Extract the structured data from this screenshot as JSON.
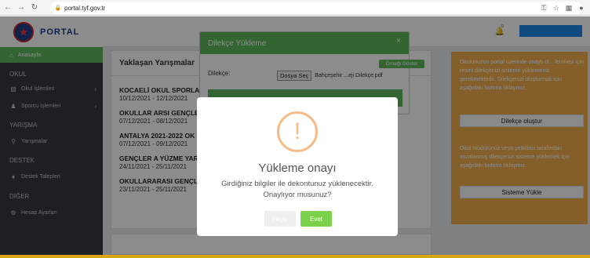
{
  "browser": {
    "url": "portal.tyf.gov.tr"
  },
  "logo": {
    "name": "PORTAL"
  },
  "sidebar": {
    "active": "Anasayfa",
    "sections": {
      "okul": "OKUL",
      "yarisma": "YARIŞMA",
      "destek": "DESTEK",
      "diger": "DİĞER"
    },
    "items": {
      "okul_islemleri": "Okul İşlemleri",
      "sporcu_islemleri": "Sporcu İşlemleri",
      "yarismalar": "Yarışmalar",
      "destek_talepleri": "Destek Talepleri",
      "hesap_ayarlari": "Hesap Ayarları"
    }
  },
  "topbar": {
    "notification_count": "0"
  },
  "card": {
    "title": "Yaklaşan Yarışmalar",
    "competitions": [
      {
        "title": "KOCAELİ OKUL SPORLARI GENÇLER İL BİRİNCİLİĞİ",
        "dates": "10/12/2021 - 12/12/2021"
      },
      {
        "title": "OKULLAR ARSI GENÇLE",
        "dates": "07/12/2021 - 08/12/2021"
      },
      {
        "title": "ANTALYA 2021-2022 OK",
        "dates": "07/12/2021 - 09/12/2021"
      },
      {
        "title": "GENÇLER A YÜZME YAR",
        "dates": "24/11/2021 - 25/11/2021"
      },
      {
        "title": "OKULLARARASI GENÇLI",
        "dates": "23/11/2021 - 25/11/2021"
      }
    ]
  },
  "orange_panel": {
    "text1": "Okulunuzun portal üzerinde onaylı ol... lenmesi için resmi dilekçenizi sisteme yüklemeniz gerekmektedir. Dilekçenizi oluşturmak için aşağıdaki butona tıklayınız.",
    "button1": "Dilekçe oluştur",
    "text2": "Okul müdürünüz veya yetkiliniz tarafından imzalanmış dilekçenizi sisteme yüklemek için aşağıdaki butona tıklayınız.",
    "button2": "Sisteme Yükle"
  },
  "bg_modal": {
    "title": "Dilekçe Yükleme",
    "close": "×",
    "example_button": "Örneği Göster",
    "label": "Dilekçe:",
    "file_button": "Dosya Seç",
    "file_name": "Bahçeşehir ...eji Dilekçe.pdf"
  },
  "dialog": {
    "icon": "!",
    "title": "Yükleme onayı",
    "text": "Girdiğiniz bilgiler ile dekontunuz yüklenecektir. Onaylıyor musunuz?",
    "cancel": "Hayır",
    "confirm": "Evet"
  },
  "colors": {
    "accent_green": "#5cb85c",
    "confirm_green": "#7cd14a",
    "warning_orange": "#f0ad4e",
    "sidebar_dark": "#343a40",
    "frame_border": "#d8a60f"
  }
}
